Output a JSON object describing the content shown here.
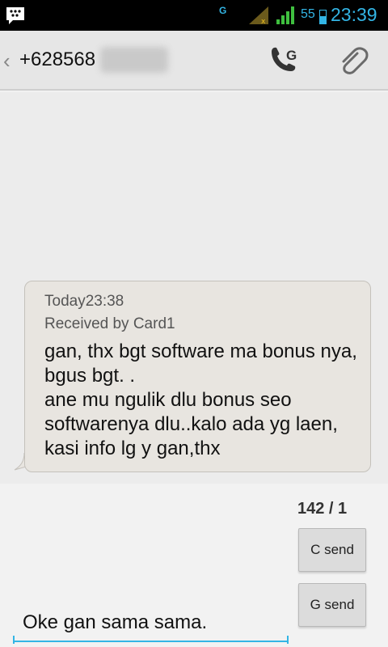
{
  "status_bar": {
    "app_icon": "bbm-icon",
    "network_type": "G",
    "battery_percent": "55",
    "battery_level": 0.55,
    "time": "23:39",
    "accent_color": "#33b5e5"
  },
  "action_bar": {
    "back_icon": "chevron-left-icon",
    "contact_number": "+628568",
    "call_icon": "phone-call-icon",
    "call_badge": "G",
    "attach_icon": "paperclip-icon"
  },
  "message": {
    "time_label": "Today23:38",
    "received_label": "Received by Card1",
    "body": "gan, thx bgt software ma bonus nya, bgus bgt. .\nane mu ngulik dlu bonus seo softwarenya dlu..kalo ada yg laen, kasi info lg y gan,thx"
  },
  "compose": {
    "char_counter": "142 / 1",
    "send_c_label": "C send",
    "send_g_label": "G send",
    "input_value": "Oke gan sama sama."
  }
}
